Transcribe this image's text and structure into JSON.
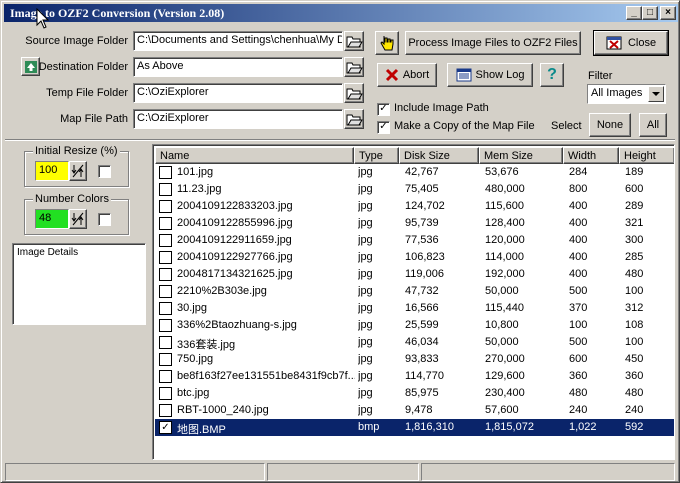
{
  "window": {
    "title": "Image to OZF2 Conversion (Version 2.08)"
  },
  "title_buttons": {
    "minimize": "_",
    "maximize": "□",
    "close": "×"
  },
  "fields": {
    "source_label": "Source Image Folder",
    "source_value": "C:\\Documents and Settings\\chenhua\\My D",
    "dest_label": "Destination Folder",
    "dest_value": "As Above",
    "temp_label": "Temp File Folder",
    "temp_value": "C:\\OziExplorer",
    "map_label": "Map File Path",
    "map_value": "C:\\OziExplorer"
  },
  "buttons": {
    "process": "Process Image Files to OZF2 Files",
    "close": "Close",
    "abort": "Abort",
    "show_log": "Show Log",
    "help": "?",
    "select_none": "None",
    "select_all": "All"
  },
  "options": {
    "include_image_path": {
      "label": "Include Image Path",
      "checked": true
    },
    "copy_map_file": {
      "label": "Make a Copy of the Map File",
      "checked": true
    }
  },
  "filter": {
    "label": "Filter",
    "value": "All Images"
  },
  "select_label": "Select",
  "left_panel": {
    "resize_title": "Initial Resize (%)",
    "resize_value": "100",
    "colors_title": "Number Colors",
    "colors_value": "48",
    "details_label": "Image Details"
  },
  "table": {
    "columns": [
      "Name",
      "Type",
      "Disk Size",
      "Mem Size",
      "Width",
      "Height"
    ],
    "rows": [
      {
        "name": "101.jpg",
        "type": "jpg",
        "disk": "42,767",
        "mem": "53,676",
        "width": "284",
        "height": "189",
        "checked": false
      },
      {
        "name": "11.23.jpg",
        "type": "jpg",
        "disk": "75,405",
        "mem": "480,000",
        "width": "800",
        "height": "600",
        "checked": false
      },
      {
        "name": "2004109122833203.jpg",
        "type": "jpg",
        "disk": "124,702",
        "mem": "115,600",
        "width": "400",
        "height": "289",
        "checked": false
      },
      {
        "name": "2004109122855996.jpg",
        "type": "jpg",
        "disk": "95,739",
        "mem": "128,400",
        "width": "400",
        "height": "321",
        "checked": false
      },
      {
        "name": "2004109122911659.jpg",
        "type": "jpg",
        "disk": "77,536",
        "mem": "120,000",
        "width": "400",
        "height": "300",
        "checked": false
      },
      {
        "name": "2004109122927766.jpg",
        "type": "jpg",
        "disk": "106,823",
        "mem": "114,000",
        "width": "400",
        "height": "285",
        "checked": false
      },
      {
        "name": "2004817134321625.jpg",
        "type": "jpg",
        "disk": "119,006",
        "mem": "192,000",
        "width": "400",
        "height": "480",
        "checked": false
      },
      {
        "name": "2210%2B303e.jpg",
        "type": "jpg",
        "disk": "47,732",
        "mem": "50,000",
        "width": "500",
        "height": "100",
        "checked": false
      },
      {
        "name": "30.jpg",
        "type": "jpg",
        "disk": "16,566",
        "mem": "115,440",
        "width": "370",
        "height": "312",
        "checked": false
      },
      {
        "name": "336%2Btaozhuang-s.jpg",
        "type": "jpg",
        "disk": "25,599",
        "mem": "10,800",
        "width": "100",
        "height": "108",
        "checked": false
      },
      {
        "name": "336套装.jpg",
        "type": "jpg",
        "disk": "46,034",
        "mem": "50,000",
        "width": "500",
        "height": "100",
        "checked": false
      },
      {
        "name": "750.jpg",
        "type": "jpg",
        "disk": "93,833",
        "mem": "270,000",
        "width": "600",
        "height": "450",
        "checked": false
      },
      {
        "name": "be8f163f27ee131551be8431f9cb7f...",
        "type": "jpg",
        "disk": "114,770",
        "mem": "129,600",
        "width": "360",
        "height": "360",
        "checked": false
      },
      {
        "name": "btc.jpg",
        "type": "jpg",
        "disk": "85,975",
        "mem": "230,400",
        "width": "480",
        "height": "480",
        "checked": false
      },
      {
        "name": "RBT-1000_240.jpg",
        "type": "jpg",
        "disk": "9,478",
        "mem": "57,600",
        "width": "240",
        "height": "240",
        "checked": false
      },
      {
        "name": "地图.BMP",
        "type": "bmp",
        "disk": "1,816,310",
        "mem": "1,815,072",
        "width": "1,022",
        "height": "592",
        "checked": true,
        "selected": true
      }
    ]
  }
}
